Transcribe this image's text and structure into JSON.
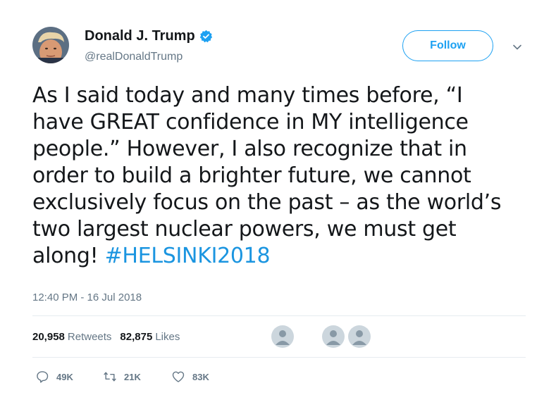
{
  "user": {
    "name": "Donald J. Trump",
    "handle": "@realDonaldTrump",
    "verified": true
  },
  "follow_button": {
    "label": "Follow"
  },
  "tweet": {
    "lines": [
      "As I said today and many times before, “I",
      "have GREAT confidence in MY intelligence",
      "people.” However, I also recognize that in",
      "order to build a brighter future, we cannot",
      "exclusively focus on the past – as the world’s",
      "two largest nuclear powers, we must get",
      "along! "
    ],
    "hashtag": "#HELSINKI2018",
    "timestamp": "12:40 PM - 16 Jul 2018"
  },
  "stats": {
    "retweets_count": "20,958",
    "retweets_label": "Retweets",
    "likes_count": "82,875",
    "likes_label": "Likes"
  },
  "actions": {
    "replies": "49K",
    "retweets": "21K",
    "likes": "83K"
  },
  "colors": {
    "accent": "#1da1f2",
    "hashtag": "#1b95e0",
    "muted": "#657786",
    "divider": "#e6ecf0",
    "placeholder_avatar": "#ccd6dd"
  }
}
